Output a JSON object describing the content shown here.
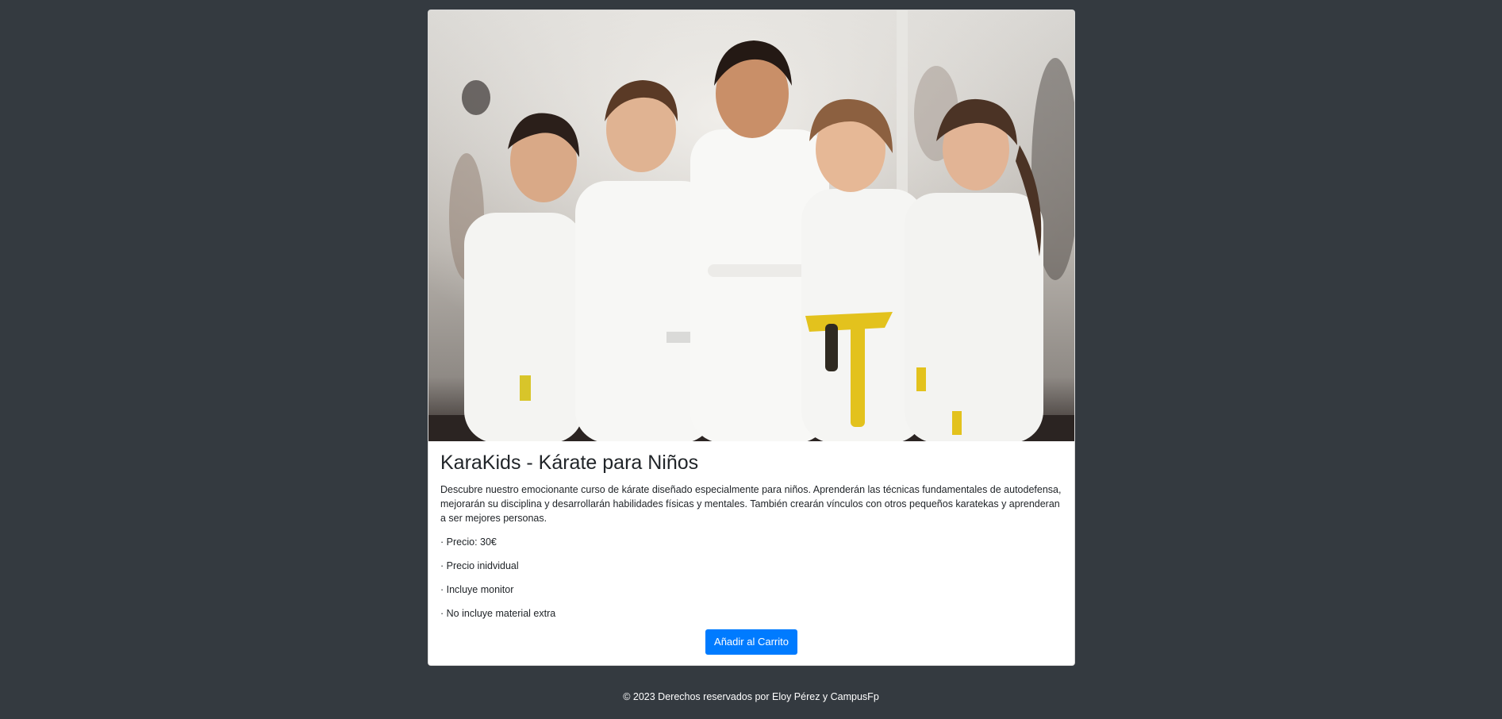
{
  "product": {
    "image_alt": "Niños con karategi sonriendo",
    "title": "KaraKids - Kárate para Niños",
    "description": "Descubre nuestro emocionante curso de kárate diseñado especialmente para niños. Aprenderán las técnicas fundamentales de autodefensa, mejorarán su disciplina y desarrollarán habilidades físicas y mentales. También crearán vínculos con otros pequeños karatekas y aprenderan a ser mejores personas.",
    "features": [
      "· Precio: 30€",
      "· Precio inidvidual",
      "· Incluye monitor",
      "· No incluye material extra"
    ],
    "add_to_cart_label": "Añadir al Carrito"
  },
  "footer": {
    "text": "© 2023 Derechos reservados por Eloy Pérez y CampusFp"
  },
  "colors": {
    "page_background": "#343a40",
    "card_background": "#ffffff",
    "button": "#007bff"
  }
}
